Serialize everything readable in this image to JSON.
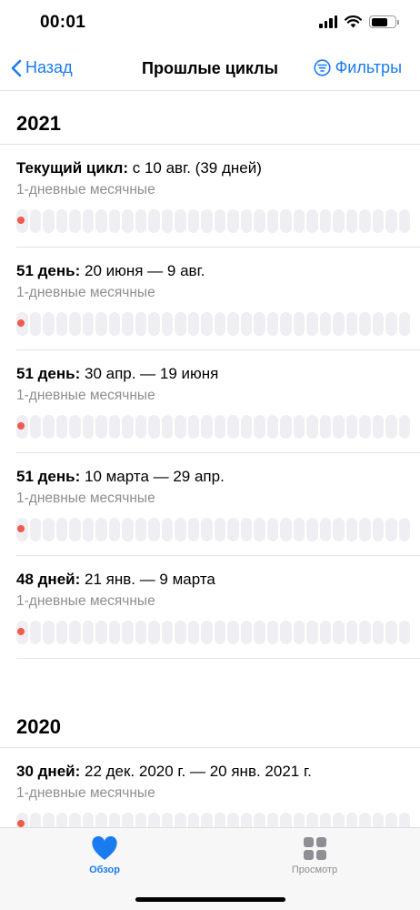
{
  "status_bar": {
    "time": "00:01"
  },
  "nav": {
    "back_label": "Назад",
    "title": "Прошлые циклы",
    "filters_label": "Фильтры"
  },
  "sections": [
    {
      "year": "2021",
      "cycles": [
        {
          "length": "Текущий цикл:",
          "dates": " с 10 авг. (39 дней)",
          "period": "1-дневные месячные",
          "period_days": 1
        },
        {
          "length": "51 день:",
          "dates": " 20 июня — 9 авг.",
          "period": "1-дневные месячные",
          "period_days": 1
        },
        {
          "length": "51 день:",
          "dates": " 30 апр. — 19 июня",
          "period": "1-дневные месячные",
          "period_days": 1
        },
        {
          "length": "51 день:",
          "dates": " 10 марта — 29 апр.",
          "period": "1-дневные месячные",
          "period_days": 1
        },
        {
          "length": "48 дней:",
          "dates": " 21 янв. — 9 марта",
          "period": "1-дневные месячные",
          "period_days": 1
        }
      ]
    },
    {
      "year": "2020",
      "cycles": [
        {
          "length": "30 дней:",
          "dates": " 22 дек. 2020 г. — 20 янв. 2021 г.",
          "period": "1-дневные месячные",
          "period_days": 1
        }
      ]
    }
  ],
  "tabs": [
    {
      "label": "Обзор",
      "icon": "heart-icon",
      "active": true
    },
    {
      "label": "Просмотр",
      "icon": "grid-icon",
      "active": false
    }
  ],
  "colors": {
    "accent": "#1a7bf0",
    "period": "#ef5b4c",
    "track": "#efeff3"
  }
}
